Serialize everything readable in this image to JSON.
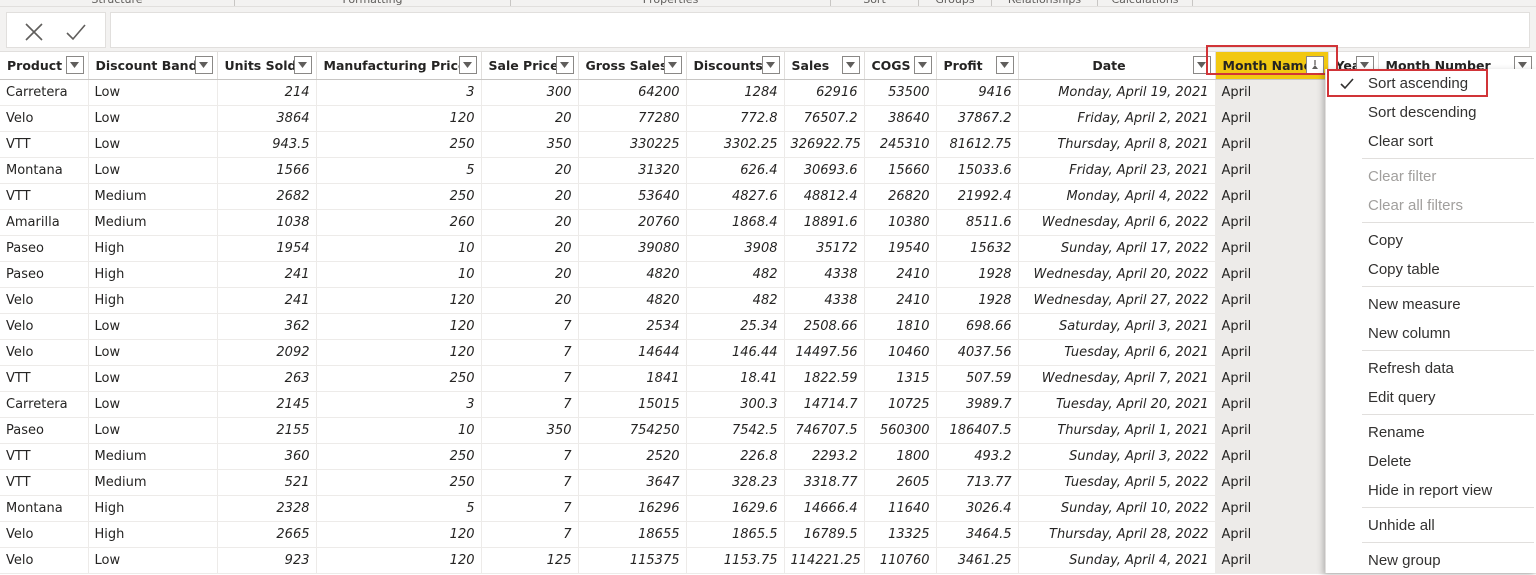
{
  "ribbon": {
    "groups": [
      "Structure",
      "Formatting",
      "Properties",
      "Sort",
      "Groups",
      "Relationships",
      "Calculations"
    ]
  },
  "formula_bar": {
    "cancel_icon": "close-icon",
    "commit_icon": "check-icon",
    "value": ""
  },
  "table": {
    "columns": [
      {
        "label": "Product",
        "align": "left"
      },
      {
        "label": "Discount Band",
        "align": "left"
      },
      {
        "label": "Units Sold",
        "align": "right"
      },
      {
        "label": "Manufacturing Price",
        "align": "right"
      },
      {
        "label": "Sale Price",
        "align": "right"
      },
      {
        "label": "Gross Sales",
        "align": "right"
      },
      {
        "label": "Discounts",
        "align": "right"
      },
      {
        "label": "Sales",
        "align": "right"
      },
      {
        "label": "COGS",
        "align": "right"
      },
      {
        "label": "Profit",
        "align": "right"
      },
      {
        "label": "Date",
        "align": "right"
      },
      {
        "label": "Month Name",
        "align": "left"
      },
      {
        "label": "Year",
        "align": "right"
      },
      {
        "label": "Month Number",
        "align": "right"
      }
    ],
    "rows": [
      [
        "Carretera",
        "Low",
        "214",
        "3",
        "300",
        "64200",
        "1284",
        "62916",
        "53500",
        "9416",
        "Monday, April 19, 2021",
        "April"
      ],
      [
        "Velo",
        "Low",
        "3864",
        "120",
        "20",
        "77280",
        "772.8",
        "76507.2",
        "38640",
        "37867.2",
        "Friday, April 2, 2021",
        "April"
      ],
      [
        "VTT",
        "Low",
        "943.5",
        "250",
        "350",
        "330225",
        "3302.25",
        "326922.75",
        "245310",
        "81612.75",
        "Thursday, April 8, 2021",
        "April"
      ],
      [
        "Montana",
        "Low",
        "1566",
        "5",
        "20",
        "31320",
        "626.4",
        "30693.6",
        "15660",
        "15033.6",
        "Friday, April 23, 2021",
        "April"
      ],
      [
        "VTT",
        "Medium",
        "2682",
        "250",
        "20",
        "53640",
        "4827.6",
        "48812.4",
        "26820",
        "21992.4",
        "Monday, April 4, 2022",
        "April"
      ],
      [
        "Amarilla",
        "Medium",
        "1038",
        "260",
        "20",
        "20760",
        "1868.4",
        "18891.6",
        "10380",
        "8511.6",
        "Wednesday, April 6, 2022",
        "April"
      ],
      [
        "Paseo",
        "High",
        "1954",
        "10",
        "20",
        "39080",
        "3908",
        "35172",
        "19540",
        "15632",
        "Sunday, April 17, 2022",
        "April"
      ],
      [
        "Paseo",
        "High",
        "241",
        "10",
        "20",
        "4820",
        "482",
        "4338",
        "2410",
        "1928",
        "Wednesday, April 20, 2022",
        "April"
      ],
      [
        "Velo",
        "High",
        "241",
        "120",
        "20",
        "4820",
        "482",
        "4338",
        "2410",
        "1928",
        "Wednesday, April 27, 2022",
        "April"
      ],
      [
        "Velo",
        "Low",
        "362",
        "120",
        "7",
        "2534",
        "25.34",
        "2508.66",
        "1810",
        "698.66",
        "Saturday, April 3, 2021",
        "April"
      ],
      [
        "Velo",
        "Low",
        "2092",
        "120",
        "7",
        "14644",
        "146.44",
        "14497.56",
        "10460",
        "4037.56",
        "Tuesday, April 6, 2021",
        "April"
      ],
      [
        "VTT",
        "Low",
        "263",
        "250",
        "7",
        "1841",
        "18.41",
        "1822.59",
        "1315",
        "507.59",
        "Wednesday, April 7, 2021",
        "April"
      ],
      [
        "Carretera",
        "Low",
        "2145",
        "3",
        "7",
        "15015",
        "300.3",
        "14714.7",
        "10725",
        "3989.7",
        "Tuesday, April 20, 2021",
        "April"
      ],
      [
        "Paseo",
        "Low",
        "2155",
        "10",
        "350",
        "754250",
        "7542.5",
        "746707.5",
        "560300",
        "186407.5",
        "Thursday, April 1, 2021",
        "April"
      ],
      [
        "VTT",
        "Medium",
        "360",
        "250",
        "7",
        "2520",
        "226.8",
        "2293.2",
        "1800",
        "493.2",
        "Sunday, April 3, 2022",
        "April"
      ],
      [
        "VTT",
        "Medium",
        "521",
        "250",
        "7",
        "3647",
        "328.23",
        "3318.77",
        "2605",
        "713.77",
        "Tuesday, April 5, 2022",
        "April"
      ],
      [
        "Montana",
        "High",
        "2328",
        "5",
        "7",
        "16296",
        "1629.6",
        "14666.4",
        "11640",
        "3026.4",
        "Sunday, April 10, 2022",
        "April"
      ],
      [
        "Velo",
        "High",
        "2665",
        "120",
        "7",
        "18655",
        "1865.5",
        "16789.5",
        "13325",
        "3464.5",
        "Thursday, April 28, 2022",
        "April"
      ],
      [
        "Velo",
        "Low",
        "923",
        "120",
        "125",
        "115375",
        "1153.75",
        "114221.25",
        "110760",
        "3461.25",
        "Sunday, April 4, 2021",
        "April"
      ]
    ]
  },
  "context_menu": {
    "groups": [
      [
        {
          "label": "Sort ascending",
          "checked": true,
          "enabled": true
        },
        {
          "label": "Sort descending",
          "enabled": true
        },
        {
          "label": "Clear sort",
          "enabled": true
        }
      ],
      [
        {
          "label": "Clear filter",
          "enabled": false
        },
        {
          "label": "Clear all filters",
          "enabled": false
        }
      ],
      [
        {
          "label": "Copy",
          "enabled": true
        },
        {
          "label": "Copy table",
          "enabled": true
        }
      ],
      [
        {
          "label": "New measure",
          "enabled": true
        },
        {
          "label": "New column",
          "enabled": true
        }
      ],
      [
        {
          "label": "Refresh data",
          "enabled": true
        },
        {
          "label": "Edit query",
          "enabled": true
        }
      ],
      [
        {
          "label": "Rename",
          "enabled": true
        },
        {
          "label": "Delete",
          "enabled": true
        },
        {
          "label": "Hide in report view",
          "enabled": true
        }
      ],
      [
        {
          "label": "Unhide all",
          "enabled": true
        }
      ],
      [
        {
          "label": "New group",
          "enabled": true
        }
      ]
    ]
  },
  "colors": {
    "highlight_header": "#f2c811",
    "highlight_column": "#edebe9",
    "annotation_box": "#d13438",
    "accent": "#0078d4"
  }
}
